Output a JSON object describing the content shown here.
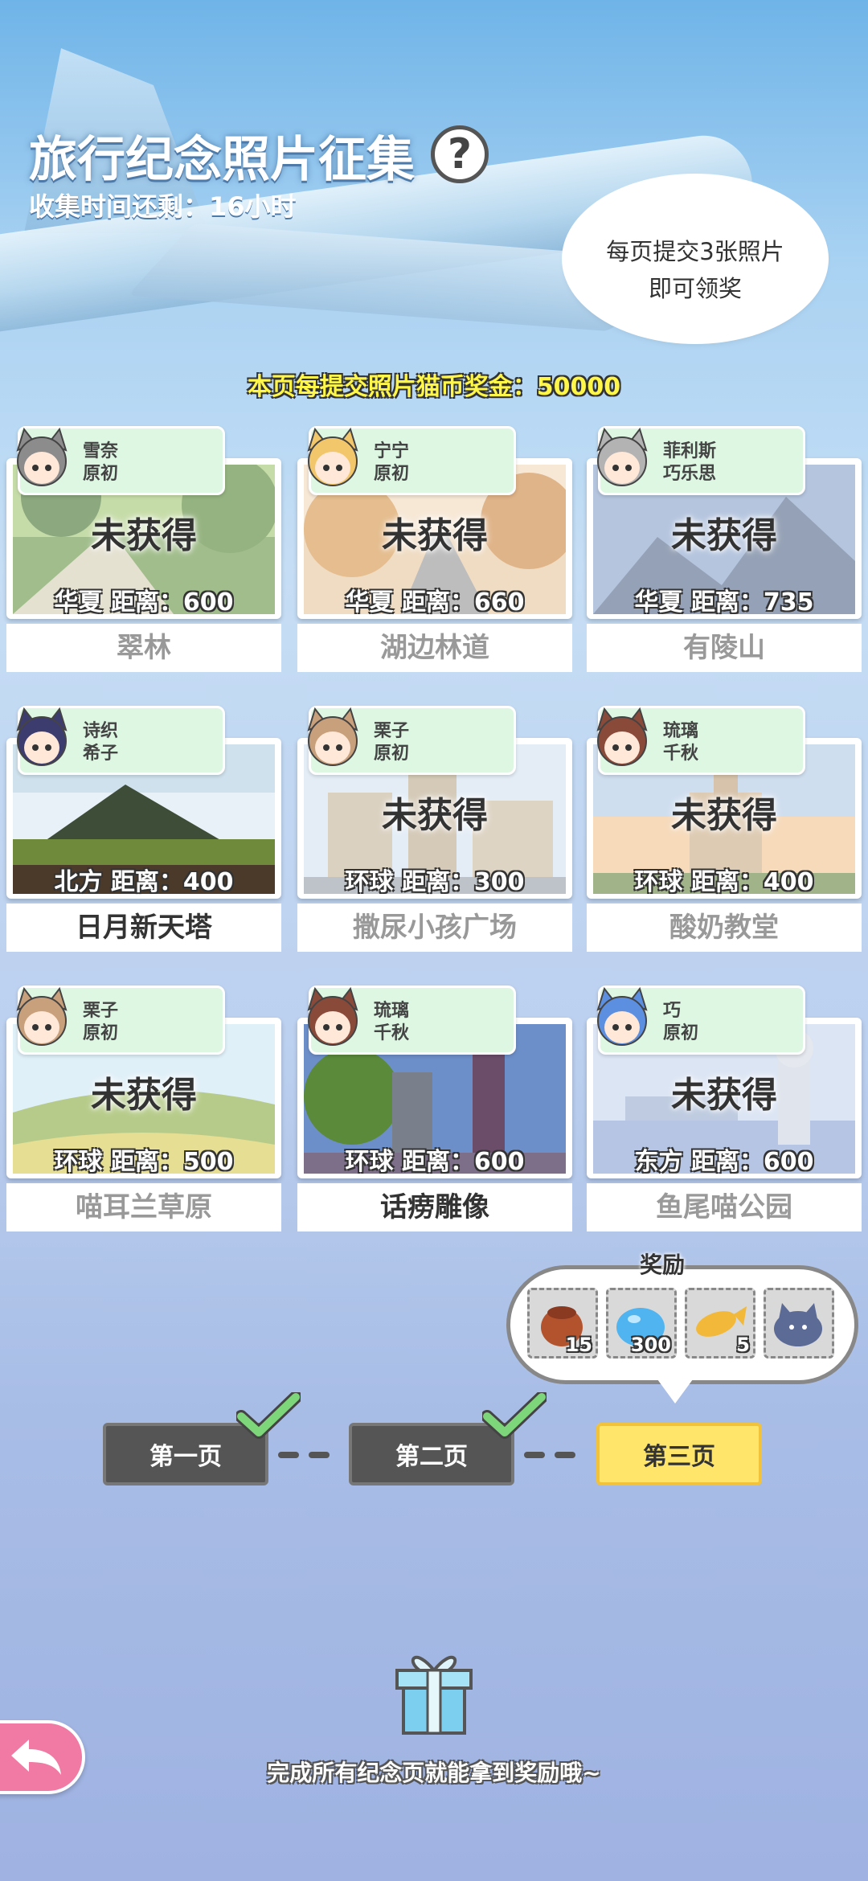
{
  "header": {
    "title": "旅行纪念照片征集",
    "help_label": "?",
    "timer": "收集时间还剩：16小时",
    "bubble_line1": "每页提交3张照片",
    "bubble_line2": "即可领奖",
    "bonus": "本页每提交照片猫币奖金：50000"
  },
  "cards": [
    {
      "name1": "雪奈",
      "name2": "原初",
      "status": "未获得",
      "dist": "华夏  距离：600",
      "label": "翠林",
      "photo": "forest"
    },
    {
      "name1": "宁宁",
      "name2": "原初",
      "status": "未获得",
      "dist": "华夏  距离：660",
      "label": "湖边林道",
      "photo": "path"
    },
    {
      "name1": "菲利斯",
      "name2": "巧乐思",
      "status": "未获得",
      "dist": "华夏  距离：735",
      "label": "有陵山",
      "photo": "mountain"
    },
    {
      "name1": "诗织",
      "name2": "希子",
      "status": "",
      "dist": "北方  距离：400",
      "label": "日月新天塔",
      "photo": "pyramid"
    },
    {
      "name1": "栗子",
      "name2": "原初",
      "status": "未获得",
      "dist": "环球  距离：300",
      "label": "撒尿小孩广场",
      "photo": "square"
    },
    {
      "name1": "琉璃",
      "name2": "千秋",
      "status": "未获得",
      "dist": "环球  距离：400",
      "label": "酸奶教堂",
      "photo": "church"
    },
    {
      "name1": "栗子",
      "name2": "原初",
      "status": "未获得",
      "dist": "环球  距离：500",
      "label": "喵耳兰草原",
      "photo": "grass"
    },
    {
      "name1": "琉璃",
      "name2": "千秋",
      "status": "",
      "dist": "环球  距离：600",
      "label": "话痨雕像",
      "photo": "statue"
    },
    {
      "name1": "巧",
      "name2": "原初",
      "status": "未获得",
      "dist": "东方  距离：600",
      "label": "鱼尾喵公园",
      "photo": "merlion"
    }
  ],
  "rewards": {
    "title": "奖励",
    "items": [
      {
        "icon": "food-bag-icon",
        "count": "15"
      },
      {
        "icon": "blue-slime-icon",
        "count": "300"
      },
      {
        "icon": "fish-icon",
        "count": "5"
      },
      {
        "icon": "cat-plush-icon",
        "count": ""
      }
    ]
  },
  "pages": [
    {
      "label": "第一页",
      "state": "done"
    },
    {
      "label": "第二页",
      "state": "done"
    },
    {
      "label": "第三页",
      "state": "current"
    }
  ],
  "footer": {
    "hint": "完成所有纪念页就能拿到奖励哦~"
  },
  "colors": {
    "accent": "#ffe66b",
    "done": "#555555",
    "check": "#7ed67a",
    "tag": "#ddf7e3"
  }
}
